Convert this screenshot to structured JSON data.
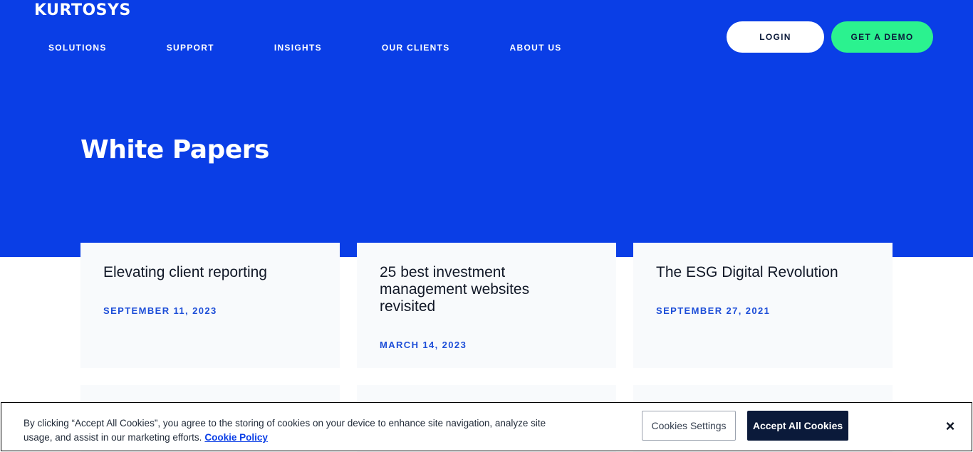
{
  "header": {
    "logo_text": "KURTOSYS",
    "nav": [
      {
        "label": "SOLUTIONS"
      },
      {
        "label": "SUPPORT"
      },
      {
        "label": "INSIGHTS"
      },
      {
        "label": "OUR CLIENTS"
      },
      {
        "label": "ABOUT US"
      }
    ],
    "login_label": "LOGIN",
    "demo_label": "GET A DEMO"
  },
  "hero": {
    "title": "White Papers"
  },
  "cards": [
    {
      "title": "Elevating client reporting",
      "date": "SEPTEMBER 11, 2023"
    },
    {
      "title": "25 best investment management websites revisited",
      "date": "MARCH 14, 2023"
    },
    {
      "title": "The ESG Digital Revolution",
      "date": "SEPTEMBER 27, 2021"
    }
  ],
  "cookie_banner": {
    "text": "By clicking “Accept All Cookies”, you agree to the storing of cookies on your device to enhance site navigation, analyze site usage, and assist in our marketing efforts.",
    "policy_link": "Cookie Policy",
    "settings_label": "Cookies Settings",
    "accept_label": "Accept All Cookies",
    "close_glyph": "×"
  },
  "colors": {
    "brand_blue": "#0a3ee6",
    "accent_green": "#2bf28f",
    "navy": "#0b1a3a",
    "date_blue": "#1d4ed8"
  }
}
